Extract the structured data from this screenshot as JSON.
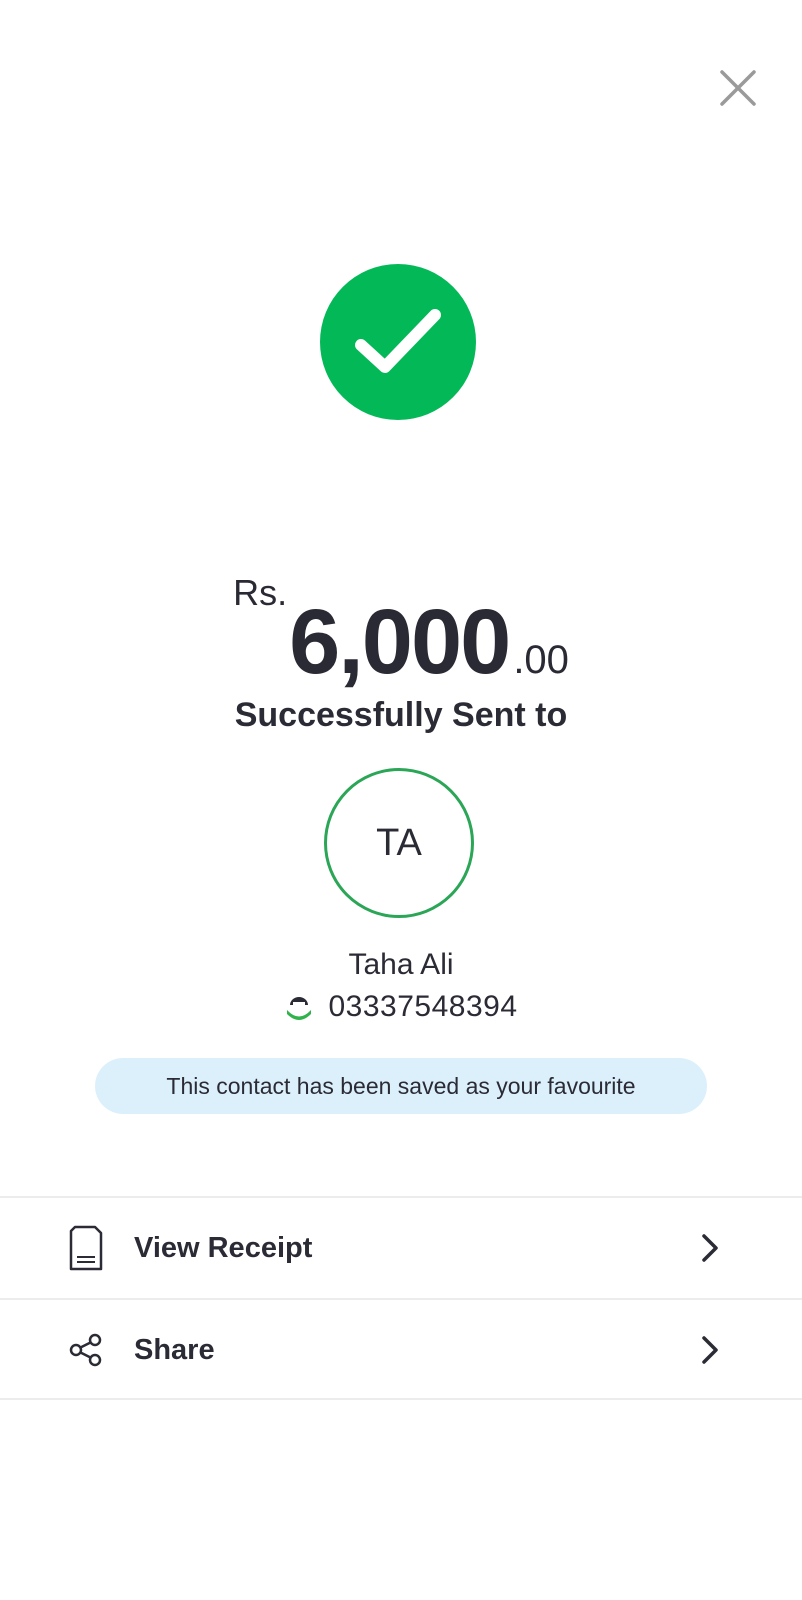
{
  "header": {
    "close_icon": "close-icon"
  },
  "status": {
    "icon": "check-icon",
    "color": "#03b957"
  },
  "amount": {
    "currency": "Rs.",
    "whole": "6,000",
    "decimal": ".00"
  },
  "status_message": "Successfully Sent to",
  "recipient": {
    "initials": "TA",
    "name": "Taha Ali",
    "phone": "03337548394",
    "network_icon": "easypaisa-logo-icon",
    "avatar_border_color": "#2aa656"
  },
  "favourite_banner": {
    "text": "This contact has been saved as your favourite",
    "background": "#dcf0fb"
  },
  "actions": [
    {
      "label": "View Receipt",
      "icon": "receipt-icon"
    },
    {
      "label": "Share",
      "icon": "share-icon"
    }
  ]
}
